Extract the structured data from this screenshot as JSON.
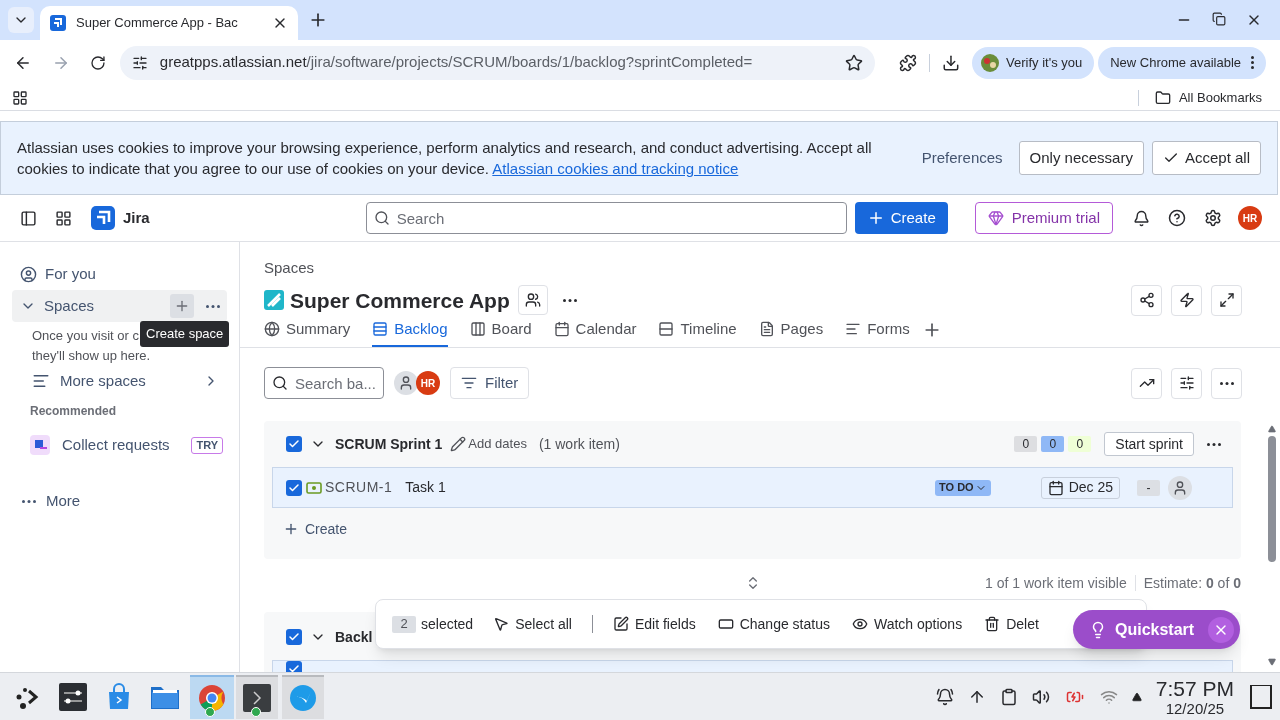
{
  "browser": {
    "tab_title": "Super Commerce App - Bac",
    "url_host": "greatpps.atlassian.net",
    "url_path": "/jira/software/projects/SCRUM/boards/1/backlog?sprintCompleted=",
    "verify": "Verify it's you",
    "update": "New Chrome available",
    "bookmarks": "All Bookmarks"
  },
  "cookie_banner": {
    "text": "Atlassian uses cookies to improve your browsing experience, perform analytics and research, and conduct advertising. Accept all cookies to indicate that you agree to our use of cookies on your device.",
    "link": "Atlassian cookies and tracking notice",
    "preferences": "Preferences",
    "only_necessary": "Only necessary",
    "accept_all": "Accept all"
  },
  "header": {
    "product": "Jira",
    "search_placeholder": "Search",
    "create": "Create",
    "premium": "Premium trial",
    "avatar": "HR"
  },
  "sidebar": {
    "for_you": "For you",
    "spaces": {
      "label": "Spaces",
      "expanded": true,
      "highlighted": true,
      "add_hovered": true
    },
    "hint_lines": [
      "Once you visit or c",
      "they'll show up here."
    ],
    "tooltip": "Create space",
    "more_spaces": "More spaces",
    "recommended": "Recommended",
    "collect": {
      "label": "Collect requests",
      "badge": "TRY"
    },
    "more": "More"
  },
  "main": {
    "breadcrumb": "Spaces",
    "title": "Super Commerce App",
    "tabs": [
      {
        "label": "Summary",
        "kind": "globe",
        "selected": false
      },
      {
        "label": "Backlog",
        "kind": "list",
        "selected": true
      },
      {
        "label": "Board",
        "kind": "columns",
        "selected": false
      },
      {
        "label": "Calendar",
        "kind": "calendar",
        "selected": false
      },
      {
        "label": "Timeline",
        "kind": "timeline",
        "selected": false
      },
      {
        "label": "Pages",
        "kind": "page",
        "selected": false
      },
      {
        "label": "Forms",
        "kind": "forms",
        "selected": false
      }
    ],
    "search_placeholder": "Search ba...",
    "avatar": "HR",
    "filter": "Filter",
    "sprint": {
      "name": "SCRUM Sprint 1",
      "checked": true,
      "expanded": true,
      "add_dates": "Add dates",
      "count": "(1 work item)",
      "counts": [
        {
          "value": "0",
          "color": "#dddee1"
        },
        {
          "value": "0",
          "color": "#8fb8f6"
        },
        {
          "value": "0",
          "color": "#efffd6"
        }
      ],
      "start": "Start sprint",
      "items": [
        {
          "key": "SCRUM-1",
          "summary": "Task 1",
          "status": "TO DO",
          "date": "Dec 25",
          "estimate": "-",
          "checked": true
        }
      ],
      "create": "Create"
    },
    "visible": "1 of 1 work item visible",
    "estimate": "Estimate: **0** of **0**",
    "backlog": {
      "name": "Backl",
      "checked": true,
      "expanded": true,
      "items": [
        {
          "checked": true
        }
      ]
    },
    "action_bar": {
      "count": "2",
      "selected_label": "selected",
      "actions": [
        {
          "label": "Select all",
          "kind": "select"
        },
        {
          "label": "Edit fields",
          "kind": "edit"
        },
        {
          "label": "Change status",
          "kind": "status"
        },
        {
          "label": "Watch options",
          "kind": "watch"
        },
        {
          "label": "Delet",
          "kind": "delete"
        }
      ]
    },
    "quickstart": "Quickstart"
  },
  "taskbar": {
    "apps": [
      {
        "kind": "launcher",
        "selected": false,
        "running": false
      },
      {
        "kind": "settings",
        "selected": false,
        "running": false
      },
      {
        "kind": "store",
        "selected": false,
        "running": false
      },
      {
        "kind": "files",
        "selected": false,
        "running": false
      },
      {
        "kind": "browser",
        "selected": true,
        "running": true
      },
      {
        "kind": "terminal",
        "selected": false,
        "running": true
      },
      {
        "kind": "bird",
        "selected": false,
        "running": true
      }
    ],
    "time": "7:57 PM",
    "date": "12/20/25"
  }
}
